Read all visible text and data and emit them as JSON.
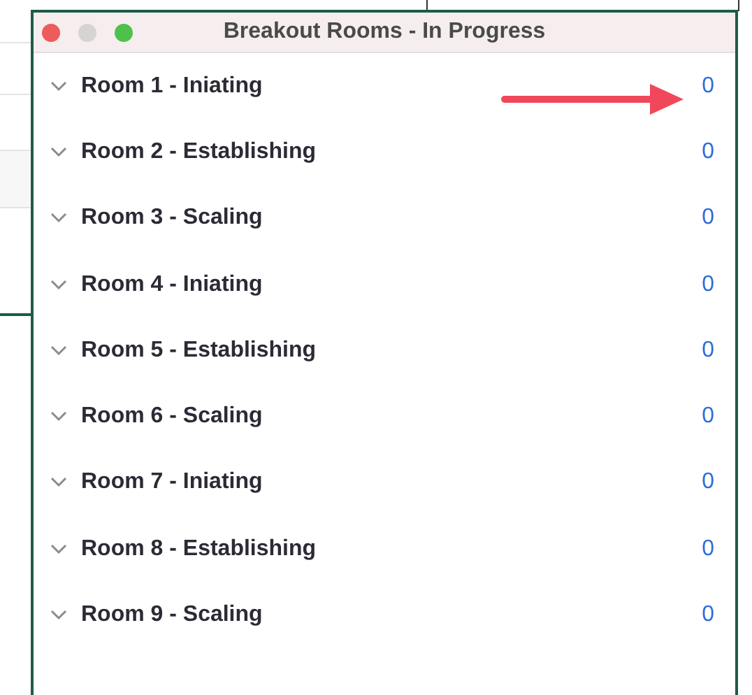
{
  "window": {
    "title": "Breakout Rooms - In Progress"
  },
  "rooms": [
    {
      "name": "Room 1 - Iniating",
      "count": "0"
    },
    {
      "name": "Room 2 - Establishing",
      "count": "0"
    },
    {
      "name": "Room 3 - Scaling",
      "count": "0"
    },
    {
      "name": "Room 4 - Iniating",
      "count": "0"
    },
    {
      "name": "Room 5 - Establishing",
      "count": "0"
    },
    {
      "name": "Room 6 - Scaling",
      "count": "0"
    },
    {
      "name": "Room 7 - Iniating",
      "count": "0"
    },
    {
      "name": "Room 8 - Establishing",
      "count": "0"
    },
    {
      "name": "Room 9 - Scaling",
      "count": "0"
    }
  ],
  "annotation": {
    "kind": "arrow"
  }
}
